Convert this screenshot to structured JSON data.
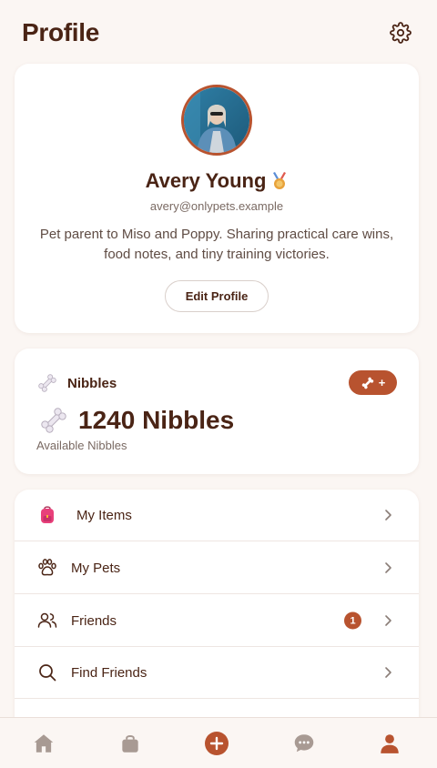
{
  "header": {
    "title": "Profile",
    "settings_icon": "gear-icon"
  },
  "profile": {
    "name": "Avery Young",
    "badge_icon": "medal-icon",
    "email": "avery@onlypets.example",
    "bio": "Pet parent to Miso and Poppy. Sharing practical care wins, food notes, and tiny training victories.",
    "edit_label": "Edit Profile"
  },
  "nibbles": {
    "label": "Nibbles",
    "amount_text": "1240 Nibbles",
    "caption": "Available Nibbles",
    "add_label": "+",
    "icon": "bone-icon"
  },
  "menu": {
    "items": [
      {
        "label": "My Items",
        "icon": "backpack-icon"
      },
      {
        "label": "My Pets",
        "icon": "paw-icon"
      },
      {
        "label": "Friends",
        "icon": "users-icon",
        "badge": "1"
      },
      {
        "label": "Find Friends",
        "icon": "search-icon"
      }
    ]
  },
  "bottom_nav": {
    "items": [
      "home-icon",
      "shop-bag-icon",
      "add-post-icon",
      "chat-icon",
      "profile-icon"
    ],
    "active": "profile-icon"
  },
  "colors": {
    "accent": "#b8532f",
    "text_dark": "#4a2415",
    "background": "#fbf6f3",
    "nav_inactive": "#a89a93"
  }
}
